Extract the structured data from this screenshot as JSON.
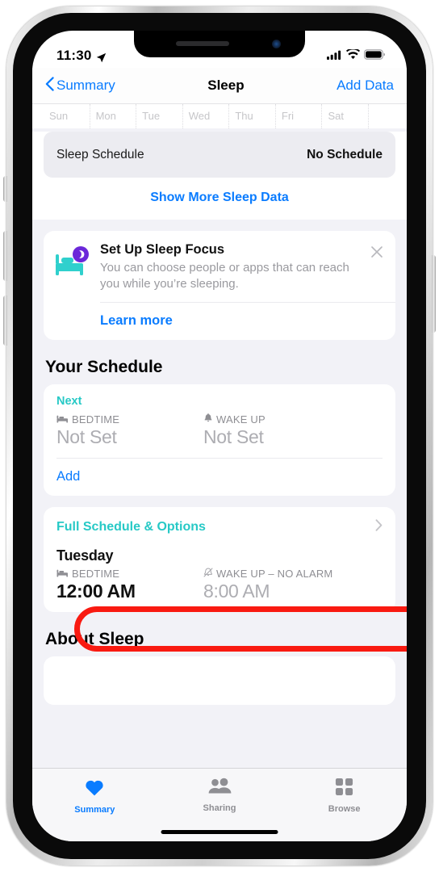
{
  "status_bar": {
    "time": "11:30",
    "location_icon": "location-arrow-icon",
    "cellular_icon": "cellular-bars-icon",
    "wifi_icon": "wifi-icon",
    "battery_icon": "battery-full-icon"
  },
  "nav": {
    "back_label": "Summary",
    "back_icon": "chevron-left-icon",
    "title": "Sleep",
    "action_label": "Add Data"
  },
  "day_strip": {
    "days": [
      "Sun",
      "Mon",
      "Tue",
      "Wed",
      "Thu",
      "Fri",
      "Sat"
    ]
  },
  "sleep_schedule_row": {
    "label": "Sleep Schedule",
    "value": "No Schedule"
  },
  "show_more_label": "Show More Sleep Data",
  "sleep_focus_card": {
    "icon": "bed-with-moon-icon",
    "title": "Set Up Sleep Focus",
    "description": "You can choose people or apps that can reach you while you’re sleeping.",
    "close_icon": "close-x-icon",
    "learn_more_label": "Learn more"
  },
  "your_schedule": {
    "section_title": "Your Schedule",
    "next_label": "Next",
    "bedtime": {
      "icon": "bed-icon",
      "label": "BEDTIME",
      "value": "Not Set"
    },
    "wakeup": {
      "icon": "bell-icon",
      "label": "WAKE UP",
      "value": "Not Set"
    },
    "add_label": "Add",
    "full_schedule_label": "Full Schedule & Options",
    "full_schedule_chevron": "chevron-right-icon",
    "day_entry": {
      "day": "Tuesday",
      "bedtime": {
        "icon": "bed-icon",
        "label": "BEDTIME",
        "value": "12:00 AM"
      },
      "wakeup": {
        "icon": "bell-slash-icon",
        "label": "WAKE UP – NO ALARM",
        "value": "8:00 AM"
      }
    }
  },
  "about_sleep": {
    "section_title": "About Sleep"
  },
  "tab_bar": {
    "tabs": [
      {
        "label": "Summary",
        "icon": "heart-icon",
        "active": true
      },
      {
        "label": "Sharing",
        "icon": "two-people-icon",
        "active": false
      },
      {
        "label": "Browse",
        "icon": "grid-squares-icon",
        "active": false
      }
    ]
  },
  "annotation": {
    "shape": "red-oval-highlight",
    "target": "Full Schedule & Options",
    "color": "#f91a11"
  },
  "colors": {
    "tint_blue": "#0a7cff",
    "tint_teal": "#27c9c6",
    "annotation_red": "#f91a11",
    "background_grey": "#f2f2f7"
  }
}
